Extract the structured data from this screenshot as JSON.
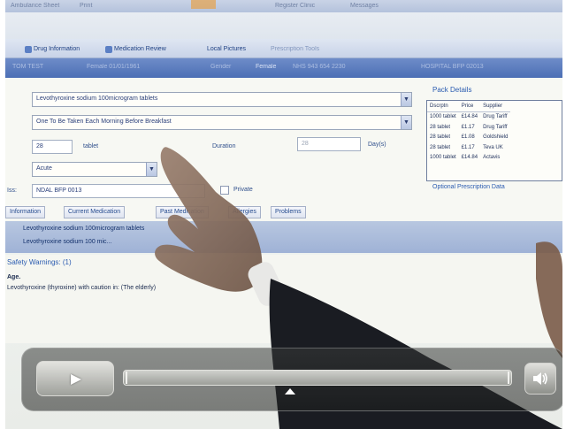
{
  "app": {
    "top_text": [
      "Ambulance Sheet",
      "Print",
      "Register Clinic",
      "Messages"
    ],
    "tabs": [
      "Drug Information",
      "Medication Review",
      "Local Pictures",
      "Prescription Tools"
    ],
    "patient_fields": [
      "TOM TEST",
      "Female 01/01/1961",
      "Gender",
      "Female",
      "NHS  943 654 2230",
      "HOSPITAL  BFP 02013"
    ]
  },
  "prescription": {
    "drug_combo": "Levothyroxine sodium 100microgram tablets",
    "dosage_combo": "One To Be Taken Each Morning Before Breakfast",
    "quantity_value": "28",
    "quantity_unit": "tablet",
    "duration_label": "Duration",
    "duration_value": "28",
    "duration_unit": "Day(s)",
    "type_combo": "Acute",
    "issue_label": "Iss:",
    "issue_value": "NDAL  BFP 0013",
    "private_label": "Private"
  },
  "pack_details": {
    "title": "Pack Details",
    "columns": [
      "Dscrptn",
      "Price",
      "Supplier"
    ],
    "rows": [
      [
        "1000 tablet",
        "£14.84",
        "Drug Tariff"
      ],
      [
        "28 tablet",
        "£1.17",
        "Drug Tariff"
      ],
      [
        "28 tablet",
        "£1.08",
        "Goldshield"
      ],
      [
        "28 tablet",
        "£1.17",
        "Teva UK"
      ],
      [
        "1000 tablet",
        "£14.84",
        "Actavis"
      ]
    ],
    "link": "Optional Prescription Data"
  },
  "lower_tabs": [
    "Information",
    "Current Medication",
    "Past Medication",
    "Allergies",
    "Problems"
  ],
  "med_list": {
    "row1": "Levothyroxine sodium 100microgram tablets",
    "row2": "Levothyroxine sodium 100 mic..."
  },
  "warnings": {
    "title": "Safety Warnings: (1)",
    "line1": "Age.",
    "line2": "Levothyroxine (thyroxine) with caution in: (The elderly)"
  },
  "player": {
    "play_icon": "play-icon",
    "volume_icon": "speaker-icon",
    "progress": 0.43
  }
}
